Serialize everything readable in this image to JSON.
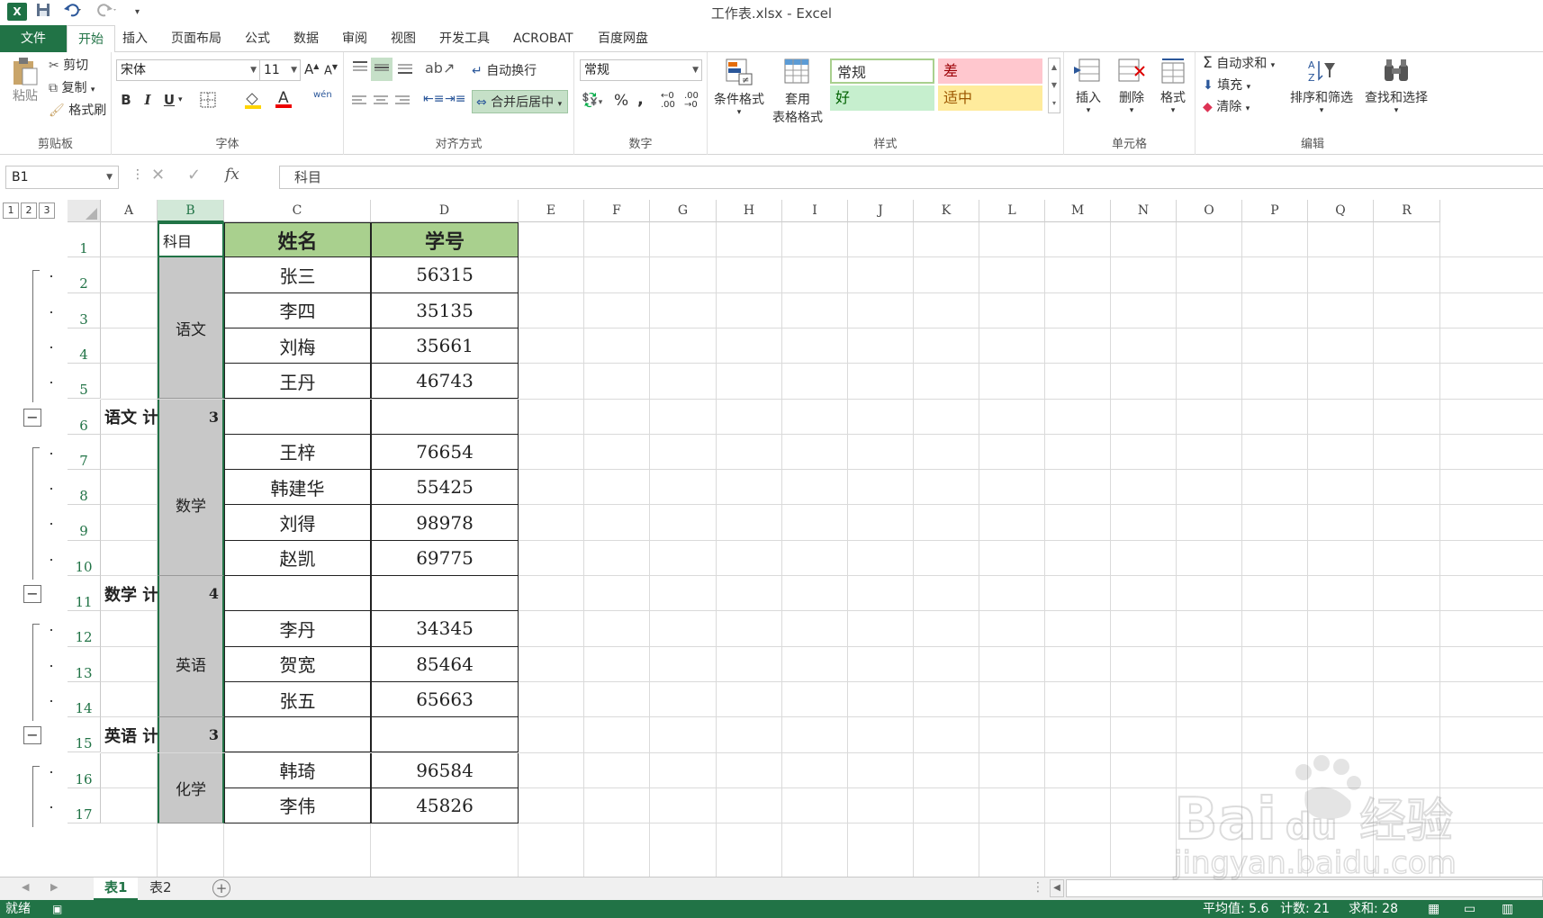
{
  "window": {
    "title": "工作表.xlsx - Excel",
    "logo": "X"
  },
  "tabs": [
    "文件",
    "开始",
    "插入",
    "页面布局",
    "公式",
    "数据",
    "审阅",
    "视图",
    "开发工具",
    "ACROBAT",
    "百度网盘"
  ],
  "ribbon": {
    "clipboard": {
      "label": "剪贴板",
      "paste": "粘贴",
      "cut": "剪切",
      "copy": "复制",
      "format_painter": "格式刷"
    },
    "font": {
      "label": "字体",
      "font_name": "宋体",
      "font_size": "11",
      "bold": "B",
      "italic": "I",
      "underline": "U",
      "phonetic": "wén"
    },
    "alignment": {
      "label": "对齐方式",
      "wrap_text": "自动换行",
      "merge_center": "合并后居中"
    },
    "number": {
      "label": "数字",
      "format": "常规",
      "percent": "%",
      "comma": ","
    },
    "styles": {
      "label": "样式",
      "conditional": "条件格式",
      "table_format_1": "套用",
      "table_format_2": "表格格式",
      "normal": "常规",
      "bad": "差",
      "good": "好",
      "neutral": "适中",
      "normal_color": "#ffffff",
      "bad_color": "#ffc7ce",
      "good_color": "#c6efce",
      "neutral_color": "#ffeb9c"
    },
    "cells": {
      "label": "单元格",
      "insert": "插入",
      "delete": "删除",
      "format": "格式"
    },
    "editing": {
      "label": "编辑",
      "autosum": "自动求和",
      "fill": "填充",
      "clear": "清除",
      "sort_filter": "排序和筛选",
      "find_select": "查找和选择"
    }
  },
  "formula_bar": {
    "name_box": "B1",
    "fx": "fx",
    "content": "科目"
  },
  "outline_levels": [
    "1",
    "2",
    "3"
  ],
  "columns": [
    "A",
    "B",
    "C",
    "D",
    "E",
    "F",
    "G",
    "H",
    "I",
    "J",
    "K",
    "L",
    "M",
    "N",
    "O",
    "P",
    "Q",
    "R"
  ],
  "rows": [
    "1",
    "2",
    "3",
    "4",
    "5",
    "6",
    "7",
    "8",
    "9",
    "10",
    "11",
    "12",
    "13",
    "14",
    "15",
    "16",
    "17"
  ],
  "sheet": {
    "header": {
      "b": "科目",
      "c": "姓名",
      "d": "学号"
    },
    "groups": [
      {
        "subject": "语文",
        "count": "3",
        "summary": "语文 计数",
        "records": [
          {
            "name": "张三",
            "id": "56315"
          },
          {
            "name": "李四",
            "id": "35135"
          },
          {
            "name": "刘梅",
            "id": "35661"
          },
          {
            "name": "王丹",
            "id": "46743"
          }
        ]
      },
      {
        "subject": "数学",
        "count": "4",
        "summary": "数学 计数",
        "records": [
          {
            "name": "王梓",
            "id": "76654"
          },
          {
            "name": "韩建华",
            "id": "55425"
          },
          {
            "name": "刘得",
            "id": "98978"
          },
          {
            "name": "赵凯",
            "id": "69775"
          }
        ]
      },
      {
        "subject": "英语",
        "count": "3",
        "summary": "英语 计数",
        "records": [
          {
            "name": "李丹",
            "id": "34345"
          },
          {
            "name": "贺宽",
            "id": "85464"
          },
          {
            "name": "张五",
            "id": "65663"
          }
        ]
      },
      {
        "subject": "化学",
        "records": [
          {
            "name": "韩琦",
            "id": "96584"
          },
          {
            "name": "李伟",
            "id": "45826"
          }
        ]
      }
    ]
  },
  "sheet_tabs": [
    "表1",
    "表2"
  ],
  "status": {
    "ready": "就绪",
    "average": "平均值: 5.6",
    "count": "计数: 21",
    "sum": "求和: 28"
  },
  "watermark": {
    "brand": "Baidu",
    "cn": "经验",
    "url": "jingyan.baidu.com"
  },
  "colors": {
    "excel_green": "#217346",
    "header_fill": "#a9d08e",
    "subject_fill": "#c8c8c8"
  }
}
